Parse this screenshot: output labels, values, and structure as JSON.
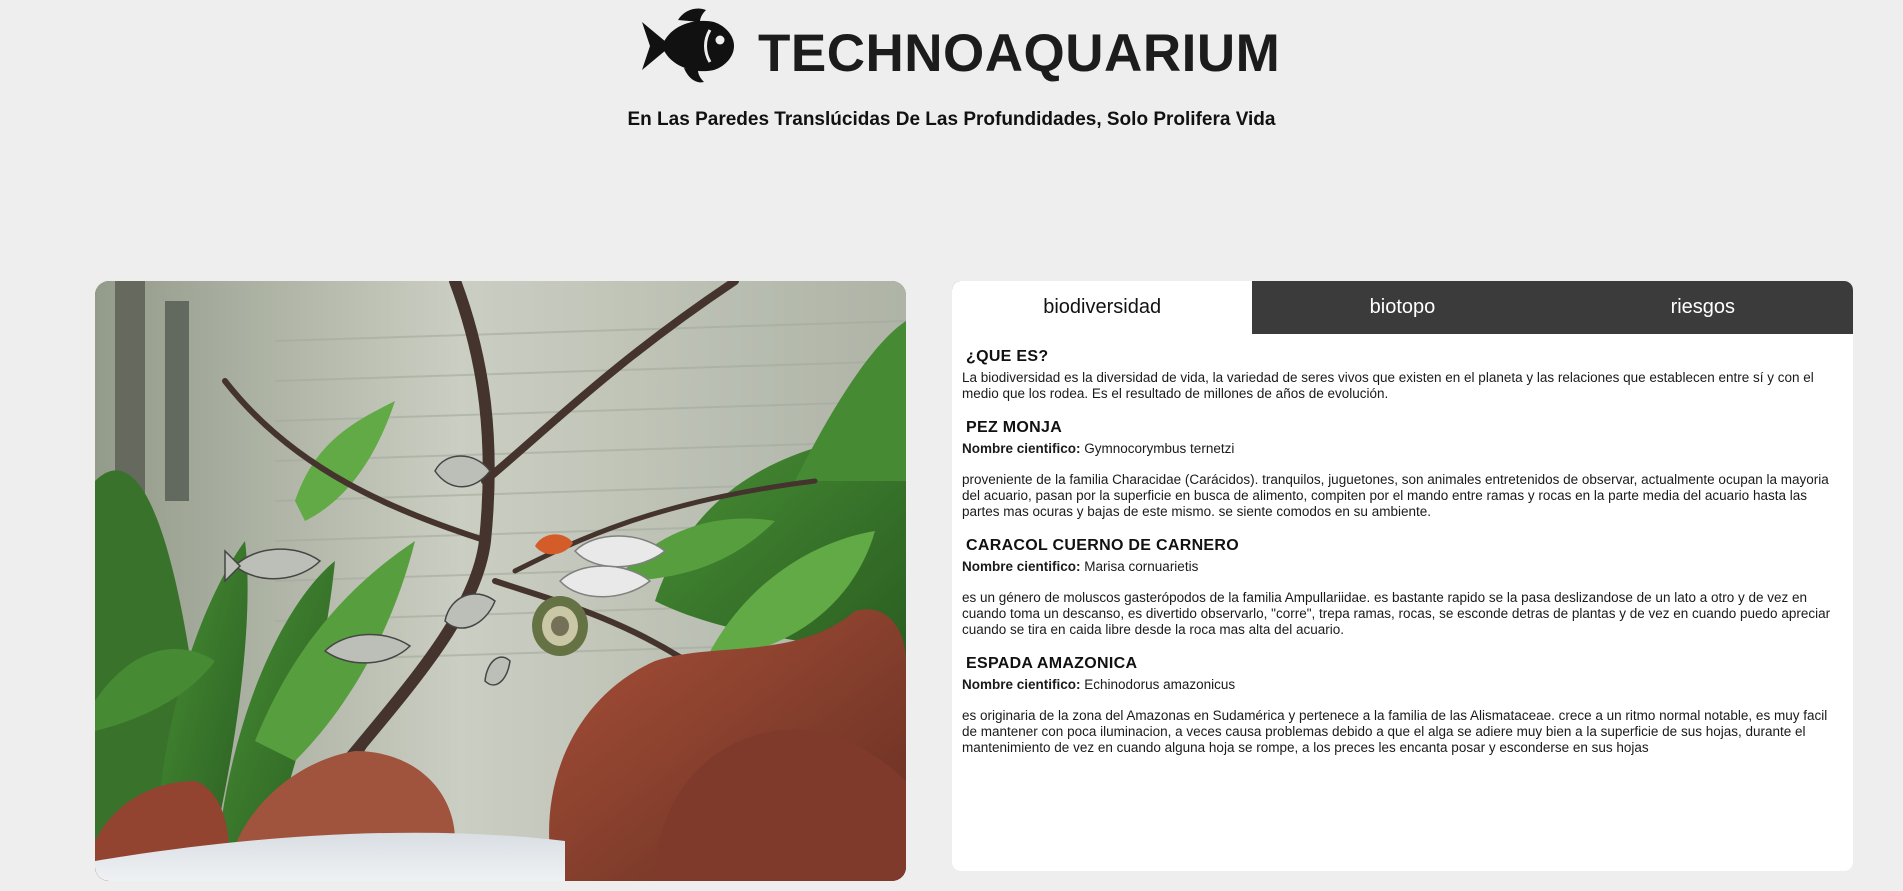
{
  "header": {
    "title": "TECHNOAQUARIUM",
    "tagline": "En Las Paredes Translúcidas De Las Profundidades, Solo Prolifera Vida",
    "logo_icon": "fish-icon"
  },
  "tabs": [
    {
      "label": "biodiversidad",
      "active": true
    },
    {
      "label": "biotopo",
      "active": false
    },
    {
      "label": "riesgos",
      "active": false
    }
  ],
  "content": {
    "intro": {
      "heading": "¿QUE ES?",
      "text": "La biodiversidad es la diversidad de vida, la variedad de seres vivos que existen en el planeta y las relaciones que establecen entre sí y con el medio que los rodea. Es el resultado de millones de años de evolución."
    },
    "species": [
      {
        "heading": "PEZ MONJA",
        "sci_label": "Nombre cientifico:",
        "sci_name": "Gymnocorymbus ternetzi",
        "text": "proveniente de la familia Characidae (Carácidos). tranquilos, juguetones, son animales entretenidos de observar, actualmente ocupan la mayoria del acuario, pasan por la superficie en busca de alimento, compiten por el mando entre ramas y rocas en la parte media del acuario hasta las partes mas ocuras y bajas de este mismo. se siente comodos en su ambiente."
      },
      {
        "heading": "CARACOL CUERNO DE CARNERO",
        "sci_label": "Nombre cientifico:",
        "sci_name": "Marisa cornuarietis",
        "text": "es un género de moluscos gasterópodos de la familia Ampullariidae. es bastante rapido se la pasa deslizandose de un lato a otro y de vez en cuando toma un descanso, es divertido observarlo, \"corre\", trepa ramas, rocas, se esconde detras de plantas y de vez en cuando puedo apreciar cuando se tira en caida libre desde la roca mas alta del acuario."
      },
      {
        "heading": "ESPADA AMAZONICA",
        "sci_label": "Nombre cientifico:",
        "sci_name": "Echinodorus amazonicus",
        "text": "es originaria de la zona del Amazonas en Sudamérica y pertenece a la familia de las Alismataceae. crece a un ritmo normal notable, es muy facil de mantener con poca iluminacion, a veces causa problemas debido a que el alga se adiere muy bien a la superficie de sus hojas, durante el mantenimiento de vez en cuando alguna hoja se rompe, a los preces les encanta posar y esconderse en sus hojas"
      }
    ]
  },
  "colors": {
    "background": "#eeeeee",
    "tab_bar": "#3b3b3b",
    "panel": "#ffffff"
  }
}
